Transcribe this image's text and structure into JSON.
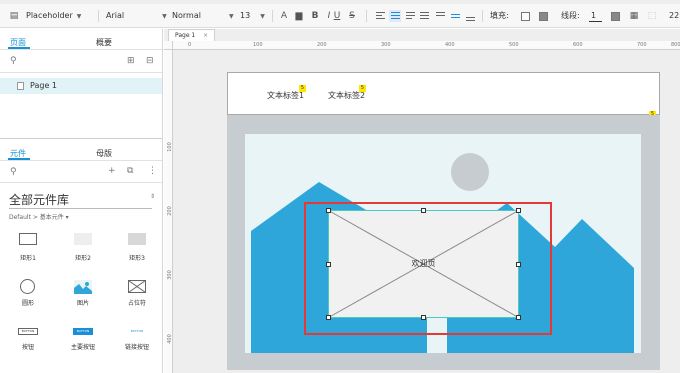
{
  "toolbar": {
    "style_select": "Placeholder",
    "font_family": "Arial",
    "font_weight": "Normal",
    "font_size": "13",
    "bold": "B",
    "italic": "I",
    "underline": "U",
    "strikethrough": "S",
    "fill_label": "填充:",
    "line_label": "线段:",
    "line_width": "1",
    "overflow_value": "22"
  },
  "left_panel": {
    "pages_tab": "页面",
    "masters_tab": "概要",
    "page_item": "Page 1",
    "widgets_tab": "元件",
    "widget_masters_tab": "母版",
    "library_title": "全部元件库",
    "library_crumb": "Default > 基本元件 ▾",
    "widgets": [
      {
        "label": "矩形1",
        "icon": "rectangle-outline-icon"
      },
      {
        "label": "矩形2",
        "icon": "rectangle-light-gray-icon"
      },
      {
        "label": "矩形3",
        "icon": "rectangle-gray-icon"
      },
      {
        "label": "圆形",
        "icon": "circle-icon"
      },
      {
        "label": "图片",
        "icon": "image-icon"
      },
      {
        "label": "占位符",
        "icon": "placeholder-icon"
      },
      {
        "label": "按钮",
        "icon": "button-icon",
        "icon_text": "BUTTON"
      },
      {
        "label": "主要按钮",
        "icon": "primary-button-icon",
        "icon_text": "BUTTON"
      },
      {
        "label": "链接按钮",
        "icon": "link-button-icon",
        "icon_text": "BUTTON"
      }
    ]
  },
  "canvas": {
    "doc_tab": "Page 1",
    "ruler_h": [
      "0",
      "100",
      "200",
      "300",
      "400",
      "500",
      "600",
      "700",
      "800"
    ],
    "ruler_v": [
      "100",
      "200",
      "300",
      "400"
    ],
    "nav_items": [
      "文本标签1",
      "文本标签2"
    ],
    "note_marker": "5",
    "placeholder_text": "欢迎页"
  },
  "colors": {
    "accent": "#1a8fd8",
    "mountain_blue": "#2fa6d9",
    "sky": "#e8f4f6",
    "sun": "#c7ccd0",
    "selection_red": "#e53935",
    "note_yellow": "#ffe800",
    "selected_page_bg": "#e1f3f7"
  }
}
